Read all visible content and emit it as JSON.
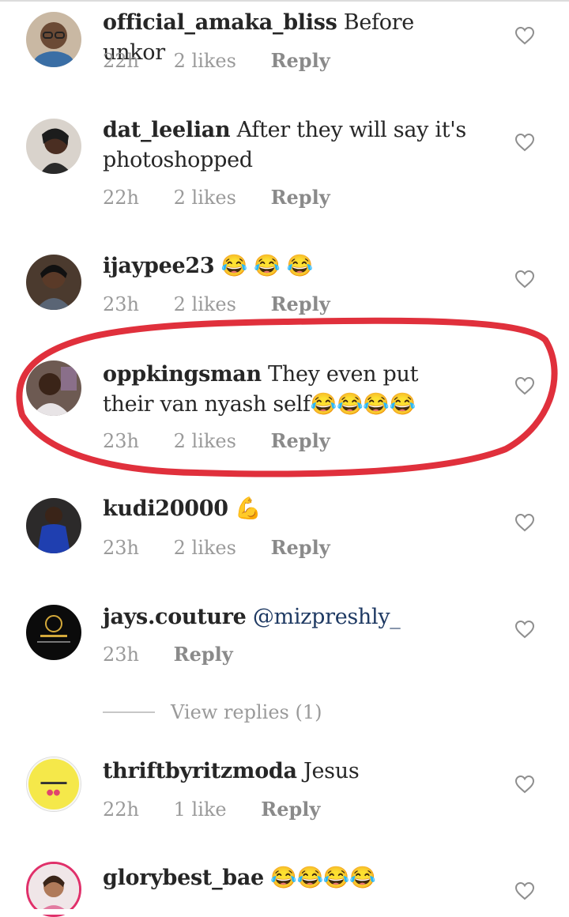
{
  "comments": [
    {
      "username": "official_amaka_bliss",
      "text": "Before unkor",
      "time": "22h",
      "likes": "2 likes",
      "reply": "Reply"
    },
    {
      "username": "dat_leelian",
      "text": "After they will say it's photoshopped",
      "time": "22h",
      "likes": "2 likes",
      "reply": "Reply"
    },
    {
      "username": "ijaypee23",
      "text": "😂 😂 😂",
      "time": "23h",
      "likes": "2 likes",
      "reply": "Reply"
    },
    {
      "username": "oppkingsman",
      "text": "They even put their van nyash self😂😂😂😂",
      "time": "23h",
      "likes": "2 likes",
      "reply": "Reply"
    },
    {
      "username": "kudi20000",
      "text": "💪",
      "time": "23h",
      "likes": "2 likes",
      "reply": "Reply"
    },
    {
      "username": "jays.couture",
      "text": "@mizpreshly_",
      "time": "23h",
      "reply": "Reply"
    },
    {
      "username": "thriftbyritzmoda",
      "text": "Jesus",
      "time": "22h",
      "likes": "1 like",
      "reply": "Reply"
    },
    {
      "username": "glorybest_bae",
      "text": "😂😂😂😂"
    }
  ],
  "view_replies": "View replies (1)",
  "icons": {
    "like": "heart-outline-icon"
  },
  "colors": {
    "highlight": "#e0303c",
    "meta": "#9a9a9a",
    "mention": "#1f3a63"
  }
}
